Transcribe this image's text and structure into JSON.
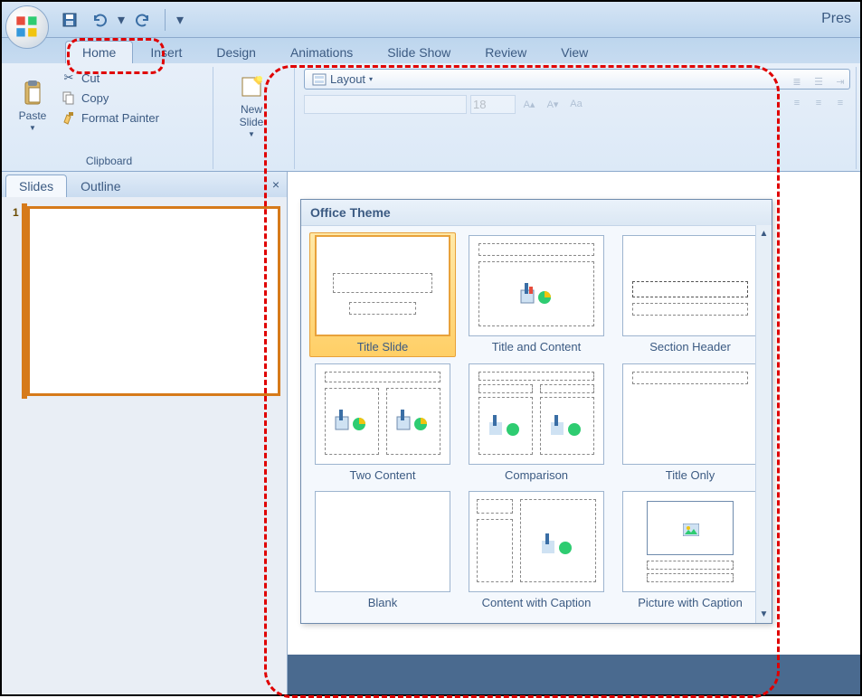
{
  "title_partial": "Pres",
  "ribbon_tabs": [
    "Home",
    "Insert",
    "Design",
    "Animations",
    "Slide Show",
    "Review",
    "View"
  ],
  "clipboard": {
    "paste": "Paste",
    "cut": "Cut",
    "copy": "Copy",
    "format_painter": "Format Painter",
    "group_label": "Clipboard"
  },
  "slides_group": {
    "new_slide": "New\nSlide",
    "layout": "Layout"
  },
  "font": {
    "size": "18"
  },
  "left_panel": {
    "tabs": [
      "Slides",
      "Outline"
    ],
    "close": "×",
    "slide_num": "1"
  },
  "gallery": {
    "header": "Office Theme",
    "layouts": [
      "Title Slide",
      "Title and Content",
      "Section Header",
      "Two Content",
      "Comparison",
      "Title Only",
      "Blank",
      "Content with Caption",
      "Picture with Caption"
    ]
  }
}
